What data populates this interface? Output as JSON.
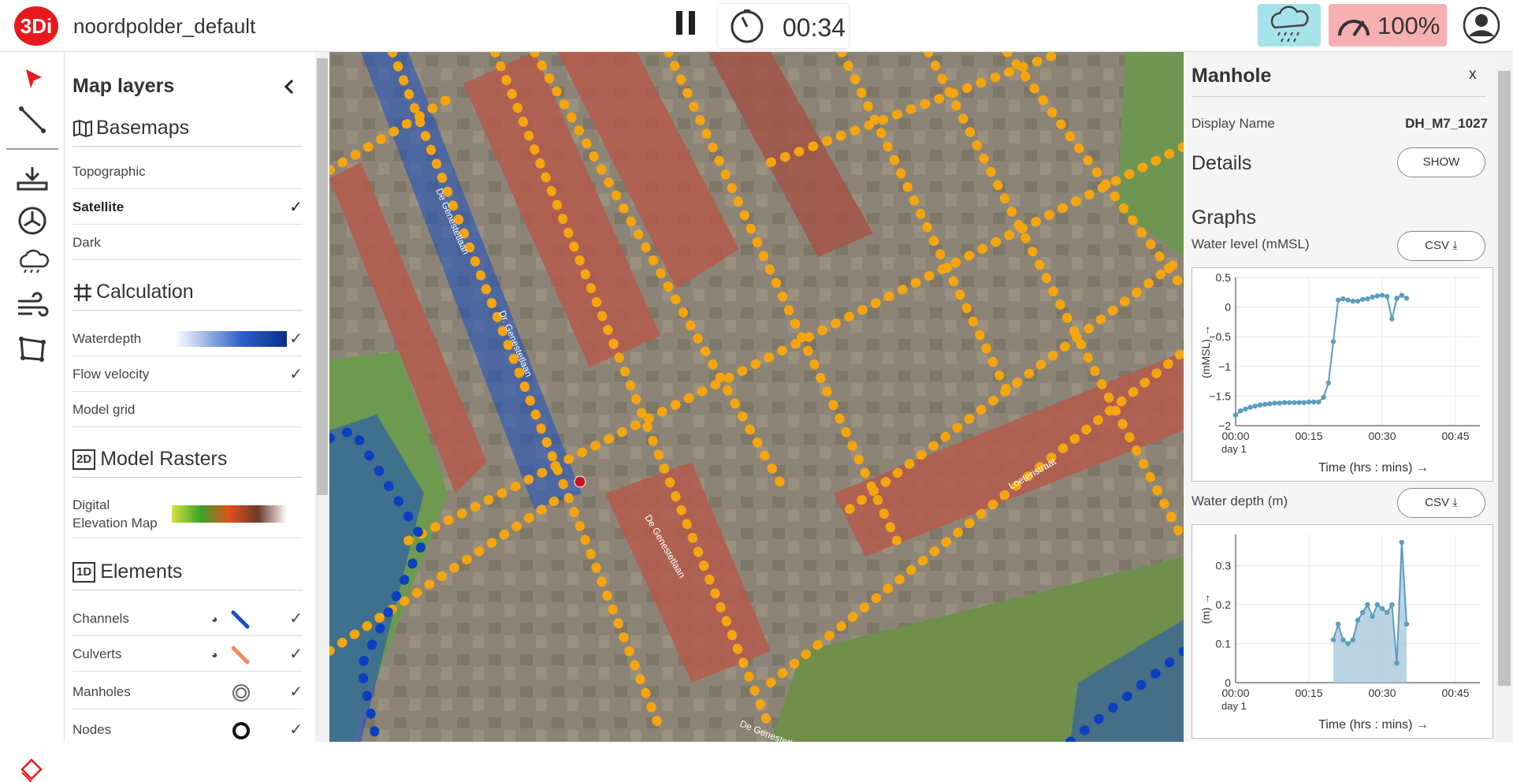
{
  "app": {
    "logo": "3Di",
    "project_name": "noordpolder_default"
  },
  "toolbar": {
    "timer": "00:34",
    "speed": "100%",
    "icons": [
      "pause-icon",
      "timer-icon",
      "rain-icon",
      "speed-icon",
      "user-icon"
    ]
  },
  "colors": {
    "brand": "#e8191d",
    "rain_bg": "#a6e3e9",
    "speed_bg": "#f7b0b1",
    "road": "#f5a50d",
    "water": "#1b4fc4",
    "series": "#5b9cc0"
  },
  "layers_panel": {
    "title": "Map layers",
    "basemaps": {
      "label": "Basemaps",
      "items": [
        {
          "label": "Topographic",
          "checked": ""
        },
        {
          "label": "Satellite",
          "checked": "✓"
        },
        {
          "label": "Dark",
          "checked": ""
        }
      ]
    },
    "calculation": {
      "label": "Calculation",
      "items": [
        {
          "label": "Waterdepth",
          "checked": "✓"
        },
        {
          "label": "Flow velocity",
          "checked": "✓"
        },
        {
          "label": "Model grid",
          "checked": ""
        }
      ]
    },
    "rasters": {
      "badge": "2D",
      "label": "Model Rasters",
      "items": [
        {
          "label_line1": "Digital",
          "label_line2": "Elevation Map"
        }
      ]
    },
    "elements": {
      "badge": "1D",
      "label": "Elements",
      "items": [
        {
          "label": "Channels",
          "checked": "✓"
        },
        {
          "label": "Culverts",
          "checked": "✓"
        },
        {
          "label": "Manholes",
          "checked": "✓"
        },
        {
          "label": "Nodes",
          "checked": "✓"
        }
      ]
    }
  },
  "map": {
    "street_labels": [
      "De Genestetlaan",
      "Dr. Genestetlaan",
      "De Genestetlaan",
      "De Genestetlaan",
      "Loeteristraat"
    ]
  },
  "manhole_panel": {
    "title": "Manhole",
    "close": "x",
    "display_name_label": "Display Name",
    "display_name_value": "DH_M7_1027",
    "details_label": "Details",
    "show_button": "SHOW",
    "graphs_label": "Graphs",
    "water_level_label": "Water level (mMSL)",
    "water_depth_label": "Water depth (m)",
    "csv_button": "CSV ⤓"
  },
  "chart_data": [
    {
      "type": "line",
      "title": "Water level (mMSL)",
      "ylabel": "(mMSL) →",
      "xlabel": "Time (hrs : mins) →",
      "x_ticks": [
        "00:00",
        "00:15",
        "00:30",
        "00:45"
      ],
      "x_sub": "day 1",
      "ylim": [
        -2,
        0.5
      ],
      "y_ticks": [
        "0.5",
        "0",
        "−0.5",
        "−1",
        "−1.5",
        "−2"
      ],
      "x": [
        0,
        1,
        2,
        3,
        4,
        5,
        6,
        7,
        8,
        9,
        10,
        11,
        12,
        13,
        14,
        15,
        16,
        17,
        18,
        19,
        20,
        21,
        22,
        23,
        24,
        25,
        26,
        27,
        28,
        29,
        30,
        31,
        32,
        33,
        34,
        35
      ],
      "y": [
        -1.82,
        -1.75,
        -1.72,
        -1.69,
        -1.67,
        -1.65,
        -1.64,
        -1.63,
        -1.62,
        -1.62,
        -1.61,
        -1.61,
        -1.61,
        -1.61,
        -1.61,
        -1.6,
        -1.6,
        -1.6,
        -1.52,
        -1.28,
        -0.58,
        0.12,
        0.14,
        0.12,
        0.1,
        0.1,
        0.13,
        0.14,
        0.17,
        0.19,
        0.2,
        0.18,
        -0.2,
        0.15,
        0.2,
        0.15
      ]
    },
    {
      "type": "area",
      "title": "Water depth (m)",
      "ylabel": "(m) →",
      "xlabel": "Time (hrs : mins) →",
      "x_ticks": [
        "00:00",
        "00:15",
        "00:30",
        "00:45"
      ],
      "x_sub": "day 1",
      "ylim": [
        0,
        0.38
      ],
      "y_ticks": [
        "0.3",
        "0.2",
        "0.1",
        "0"
      ],
      "x": [
        20,
        21,
        22,
        23,
        24,
        25,
        26,
        27,
        28,
        29,
        30,
        31,
        32,
        33,
        34,
        35
      ],
      "y": [
        0.11,
        0.15,
        0.11,
        0.1,
        0.11,
        0.16,
        0.18,
        0.2,
        0.17,
        0.2,
        0.19,
        0.18,
        0.2,
        0.05,
        0.36,
        0.15
      ]
    }
  ]
}
